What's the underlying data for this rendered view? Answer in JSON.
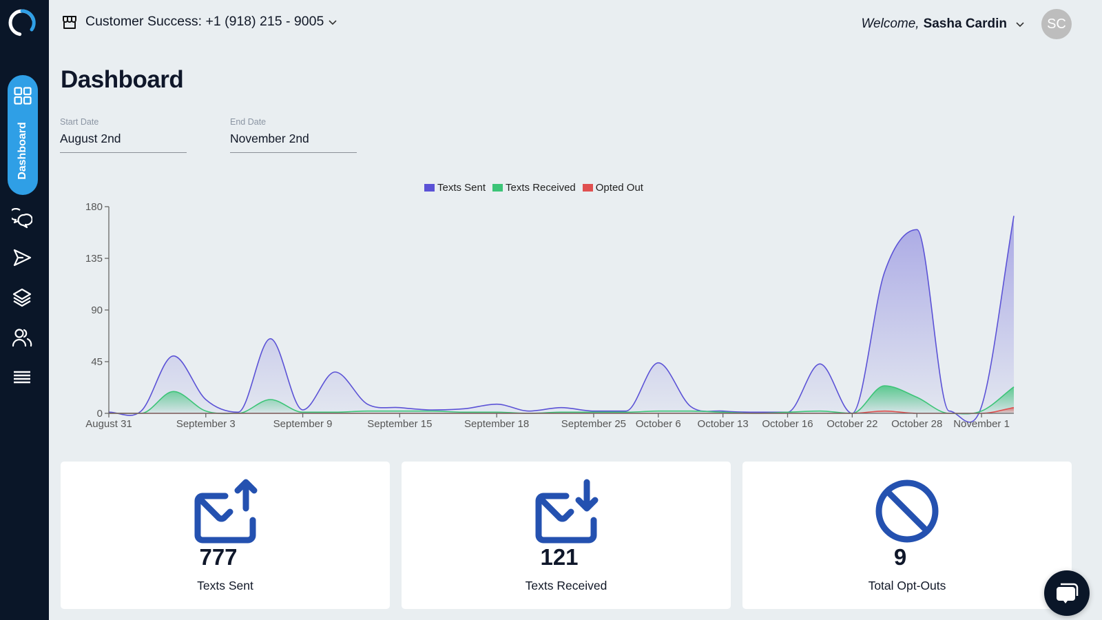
{
  "header": {
    "account_label": "Customer Success: +1 (918) 215 - 9005",
    "welcome_prefix": "Welcome,",
    "user_name": "Sasha Cardin",
    "avatar_initials": "SC"
  },
  "sidebar": {
    "items": [
      {
        "label": "Dashboard",
        "icon": "grid-icon",
        "active": true
      },
      {
        "label": "Conversations",
        "icon": "chat-bubbles-icon"
      },
      {
        "label": "Send",
        "icon": "paper-plane-icon"
      },
      {
        "label": "Layers",
        "icon": "layers-icon"
      },
      {
        "label": "Contacts",
        "icon": "users-icon"
      },
      {
        "label": "Menu",
        "icon": "menu-icon"
      }
    ]
  },
  "page": {
    "title": "Dashboard",
    "start_date": {
      "label": "Start Date",
      "value": "August 2nd"
    },
    "end_date": {
      "label": "End Date",
      "value": "November 2nd"
    }
  },
  "colors": {
    "sent": "#5b52d6",
    "received": "#3cc477",
    "opted_out": "#e05050",
    "accent": "#2f9fe6",
    "icon_blue": "#2451b0",
    "sidebar_bg": "#0a1628"
  },
  "chart_data": {
    "type": "area",
    "title": "",
    "xlabel": "",
    "ylabel": "",
    "ylim": [
      0,
      180
    ],
    "yticks": [
      0,
      45,
      90,
      135,
      180
    ],
    "x_tick_labels": [
      {
        "index": 0,
        "label": "August 31"
      },
      {
        "index": 3,
        "label": "September 3"
      },
      {
        "index": 6,
        "label": "September 9"
      },
      {
        "index": 9,
        "label": "September 15"
      },
      {
        "index": 12,
        "label": "September 18"
      },
      {
        "index": 15,
        "label": "September 25"
      },
      {
        "index": 17,
        "label": "October 6"
      },
      {
        "index": 19,
        "label": "October 13"
      },
      {
        "index": 21,
        "label": "October 16"
      },
      {
        "index": 23,
        "label": "October 22"
      },
      {
        "index": 25,
        "label": "October 28"
      },
      {
        "index": 27,
        "label": "November 1"
      }
    ],
    "legend_position": "top-center",
    "grid": false,
    "series": [
      {
        "name": "Texts Sent",
        "color": "#5b52d6",
        "values": [
          1,
          2,
          50,
          12,
          1,
          65,
          3,
          36,
          8,
          5,
          3,
          4,
          8,
          2,
          5,
          2,
          2,
          44,
          6,
          2,
          1,
          1,
          43,
          0,
          123,
          160,
          2,
          6,
          172
        ]
      },
      {
        "name": "Texts Received",
        "color": "#3cc477",
        "values": [
          0,
          0,
          19,
          2,
          0,
          12,
          1,
          1,
          2,
          2,
          2,
          1,
          1,
          0,
          1,
          1,
          1,
          2,
          2,
          1,
          0,
          1,
          2,
          0,
          24,
          14,
          0,
          2,
          23
        ]
      },
      {
        "name": "Opted Out",
        "color": "#e05050",
        "values": [
          0,
          0,
          0,
          0,
          0,
          0,
          0,
          0,
          0,
          0,
          0,
          0,
          0,
          0,
          0,
          0,
          0,
          0,
          0,
          0,
          0,
          0,
          0,
          0,
          2,
          0,
          0,
          0,
          5
        ]
      }
    ]
  },
  "stats": [
    {
      "value": "777",
      "label": "Texts Sent",
      "icon": "mail-send-icon"
    },
    {
      "value": "121",
      "label": "Texts Received",
      "icon": "mail-receive-icon"
    },
    {
      "value": "9",
      "label": "Total Opt-Outs",
      "icon": "prohibited-icon"
    }
  ]
}
